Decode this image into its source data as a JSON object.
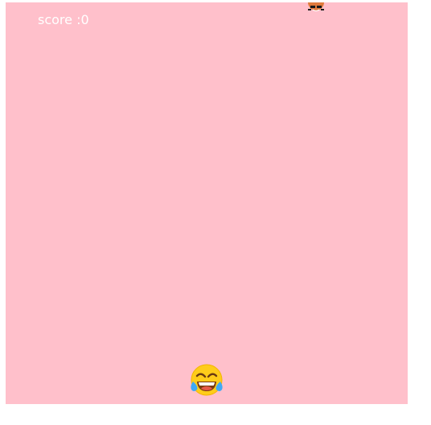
{
  "game": {
    "score_text": "score :0",
    "background_color": "#ffc0cb",
    "player": {
      "icon": "tears-of-joy-emoji-icon"
    },
    "falling_object": {
      "icon": "falling-object-icon"
    }
  }
}
